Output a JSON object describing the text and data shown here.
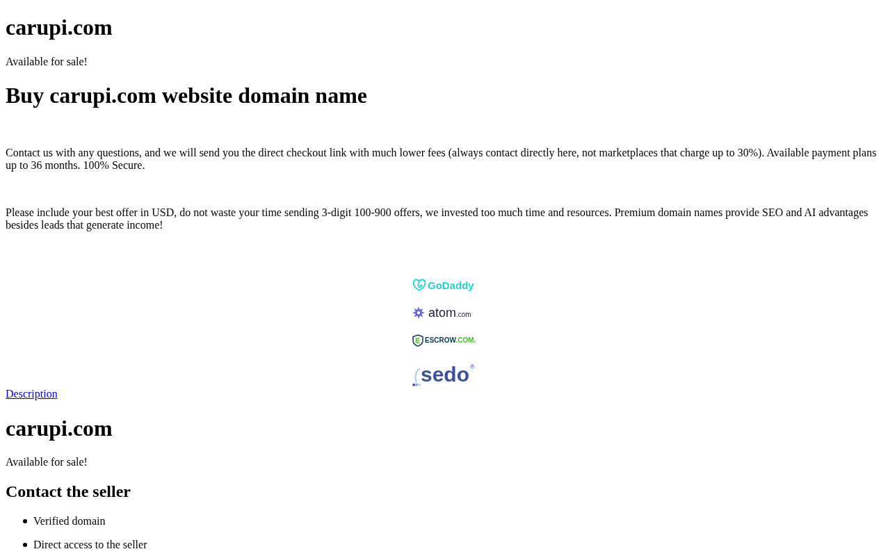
{
  "header": {
    "title": "carupi.com",
    "tagline": "Available for sale!"
  },
  "headline": "Buy carupi.com website domain name",
  "paragraphs": [
    "Contact us with any questions, and we will send you the direct checkout link with much lower fees (always contact directly here, not marketplaces that charge up to 30%). Available payment plans up to 36 months. 100% Secure.",
    "Please include your best offer in USD, do not waste your time sending 3-digit 100-900 offers, we invested too much time and resources. Premium domain names provide SEO and AI advantages besides leads that generate income!"
  ],
  "partners": [
    {
      "kind": "godaddy",
      "name": "GoDaddy"
    },
    {
      "kind": "atom",
      "name": "atom",
      "suffix": ".com"
    },
    {
      "kind": "escrow",
      "name": "ESCROW",
      "suffix": ".COM."
    },
    {
      "kind": "sedo",
      "name": "sedo",
      "suffix": "®"
    }
  ],
  "description_link": "Description",
  "section": {
    "title": "carupi.com",
    "tagline": "Available for sale!",
    "heading": "Contact the seller",
    "features": [
      "Verified domain",
      "Direct access to the seller"
    ]
  }
}
